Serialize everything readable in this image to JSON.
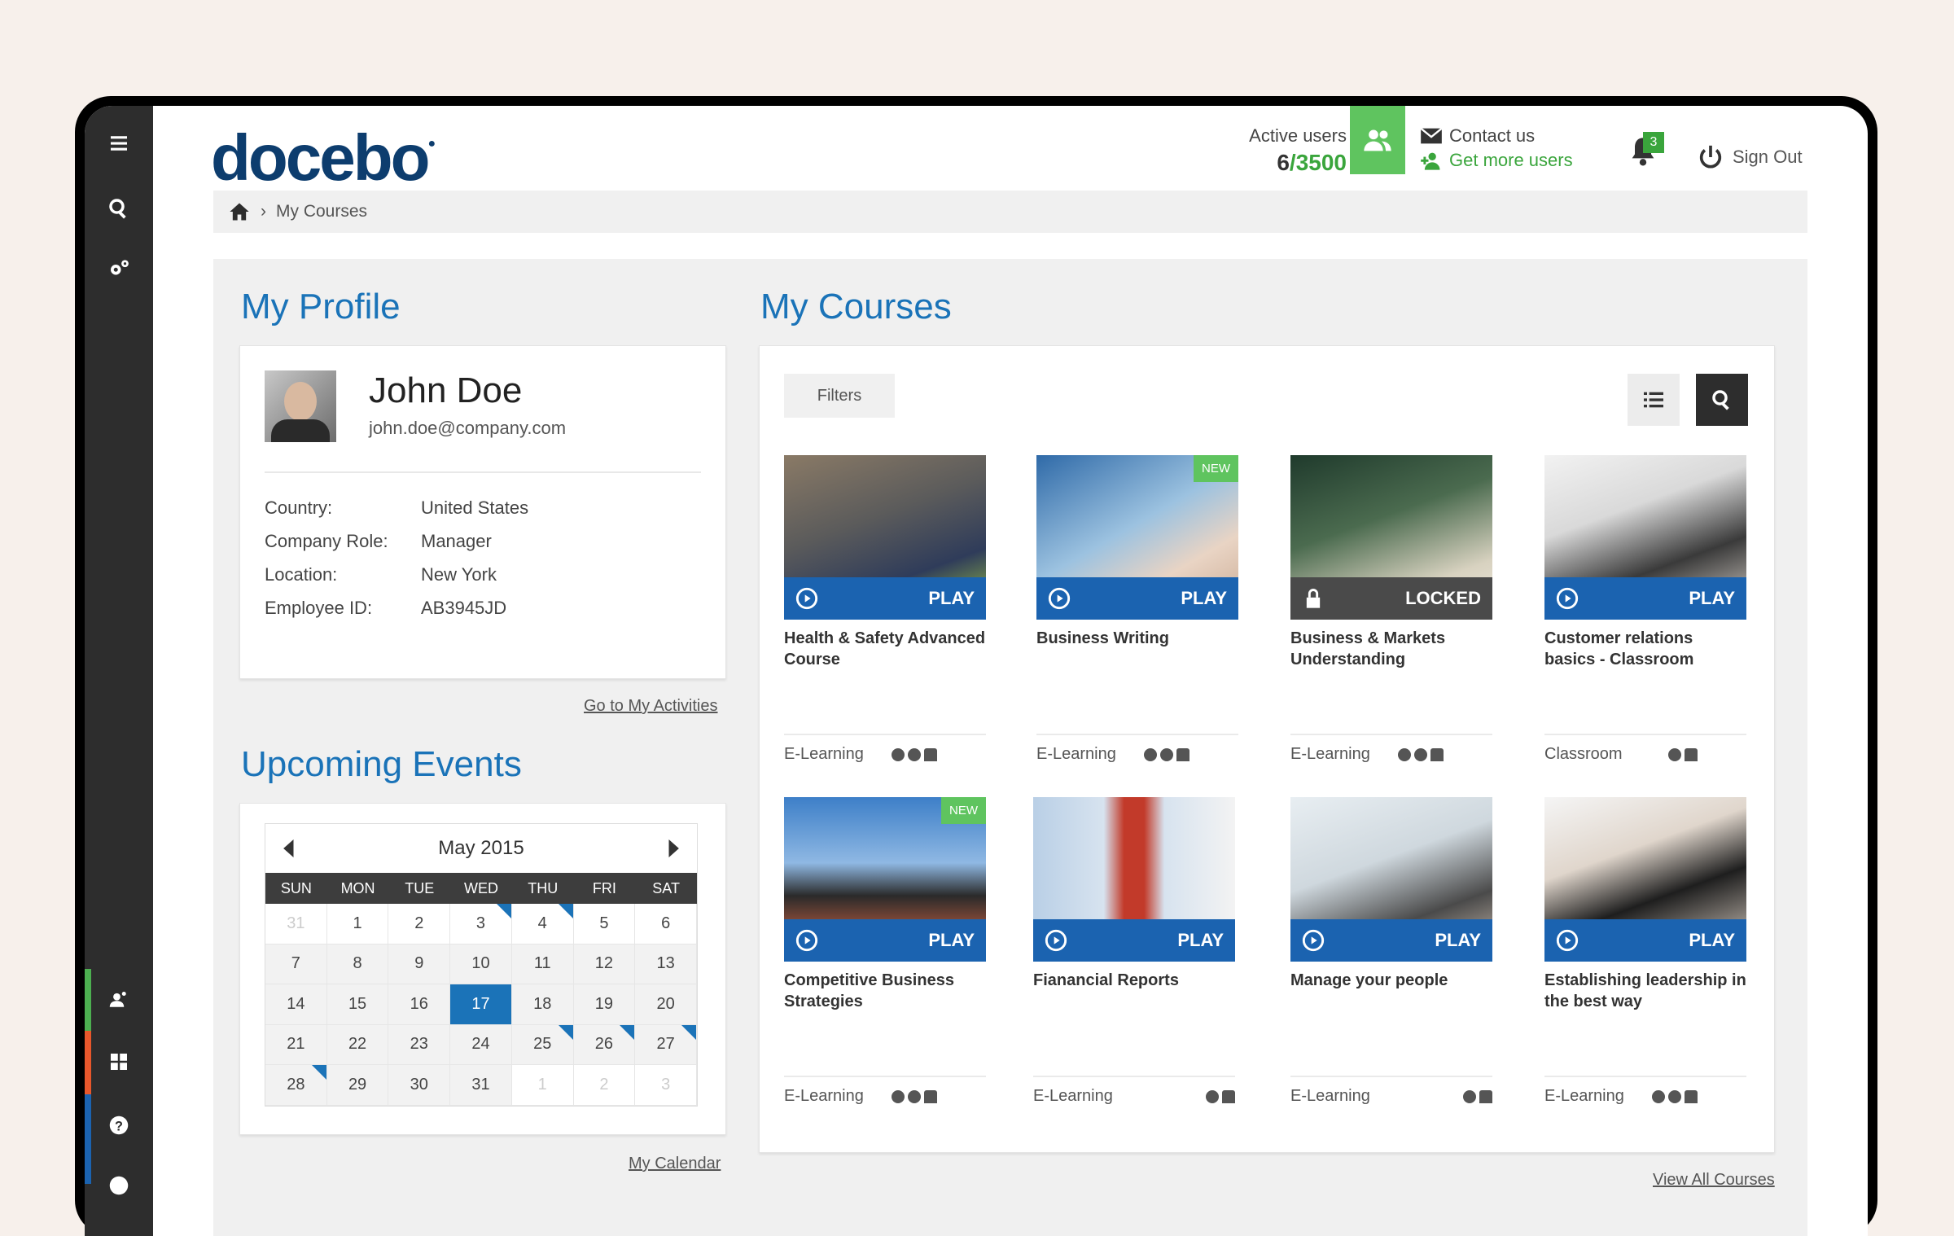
{
  "header": {
    "logo": "docebo",
    "active_users_label": "Active users",
    "active_users_current": "6",
    "active_users_max": "/3500",
    "contact_label": "Contact us",
    "get_more_label": "Get more users",
    "notification_count": "3",
    "signout_label": "Sign Out"
  },
  "breadcrumb": {
    "current": "My Courses"
  },
  "profile": {
    "title": "My Profile",
    "name": "John Doe",
    "email": "john.doe@company.com",
    "fields": [
      {
        "key": "Country:",
        "value": "United States"
      },
      {
        "key": "Company Role:",
        "value": "Manager"
      },
      {
        "key": "Location:",
        "value": "New York"
      },
      {
        "key": "Employee ID:",
        "value": "AB3945JD"
      }
    ],
    "activities_link": "Go to My Activities"
  },
  "events": {
    "title": "Upcoming Events",
    "month": "May 2015",
    "dows": [
      "SUN",
      "MON",
      "TUE",
      "WED",
      "THU",
      "FRI",
      "SAT"
    ],
    "calendar_link": "My Calendar",
    "today": "17"
  },
  "courses": {
    "title": "My Courses",
    "filters_label": "Filters",
    "view_all_link": "View All Courses",
    "items": [
      {
        "title": "Health & Safety Advanced Course",
        "type": "E-Learning",
        "action": "PLAY"
      },
      {
        "title": "Business Writing",
        "type": "E-Learning",
        "action": "PLAY",
        "badge": "NEW"
      },
      {
        "title": "Business & Markets Understanding",
        "type": "E-Learning",
        "action": "LOCKED"
      },
      {
        "title": "Customer relations basics - Classroom",
        "type": "Classroom",
        "action": "PLAY"
      },
      {
        "title": "Competitive Business Strategies",
        "type": "E-Learning",
        "action": "PLAY",
        "badge": "NEW"
      },
      {
        "title": "Fianancial Reports",
        "type": "E-Learning",
        "action": "PLAY"
      },
      {
        "title": "Manage your people",
        "type": "E-Learning",
        "action": "PLAY"
      },
      {
        "title": "Establishing leadership in the best way",
        "type": "E-Learning",
        "action": "PLAY"
      }
    ]
  },
  "colors": {
    "accent_blue": "#1b73b8",
    "accent_green": "#5fc45f",
    "rail": "#2d2d2d"
  }
}
